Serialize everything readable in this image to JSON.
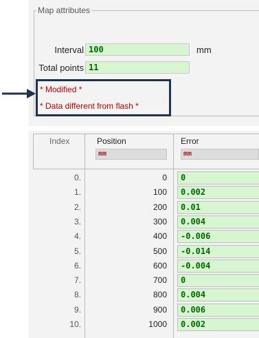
{
  "map_attributes": {
    "title": "Map attributes",
    "interval_label": "Interval",
    "interval_value": "100",
    "interval_unit": "mm",
    "total_points_label": "Total points",
    "total_points_value": "11",
    "status_modified": "* Modified *",
    "status_flash": "* Data different from flash *"
  },
  "table": {
    "headers": {
      "index": "Index",
      "position": "Position",
      "error": "Error"
    },
    "units": {
      "position": "mm",
      "error": "mm"
    },
    "rows": [
      {
        "index": "0.",
        "position": "0",
        "error": "0"
      },
      {
        "index": "1.",
        "position": "100",
        "error": "0.002"
      },
      {
        "index": "2.",
        "position": "200",
        "error": "0.01"
      },
      {
        "index": "3.",
        "position": "300",
        "error": "0.004"
      },
      {
        "index": "4.",
        "position": "400",
        "error": "-0.006"
      },
      {
        "index": "5.",
        "position": "500",
        "error": "-0.014"
      },
      {
        "index": "6.",
        "position": "600",
        "error": "-0.004"
      },
      {
        "index": "7.",
        "position": "700",
        "error": "0"
      },
      {
        "index": "8.",
        "position": "800",
        "error": "0.004"
      },
      {
        "index": "9.",
        "position": "900",
        "error": "0.006"
      },
      {
        "index": "10.",
        "position": "1000",
        "error": "0.002"
      }
    ]
  },
  "colors": {
    "field_bg": "#d7f5d0",
    "field_text": "#006a00",
    "status_text": "#c00000",
    "highlight_border": "#1d3150"
  }
}
